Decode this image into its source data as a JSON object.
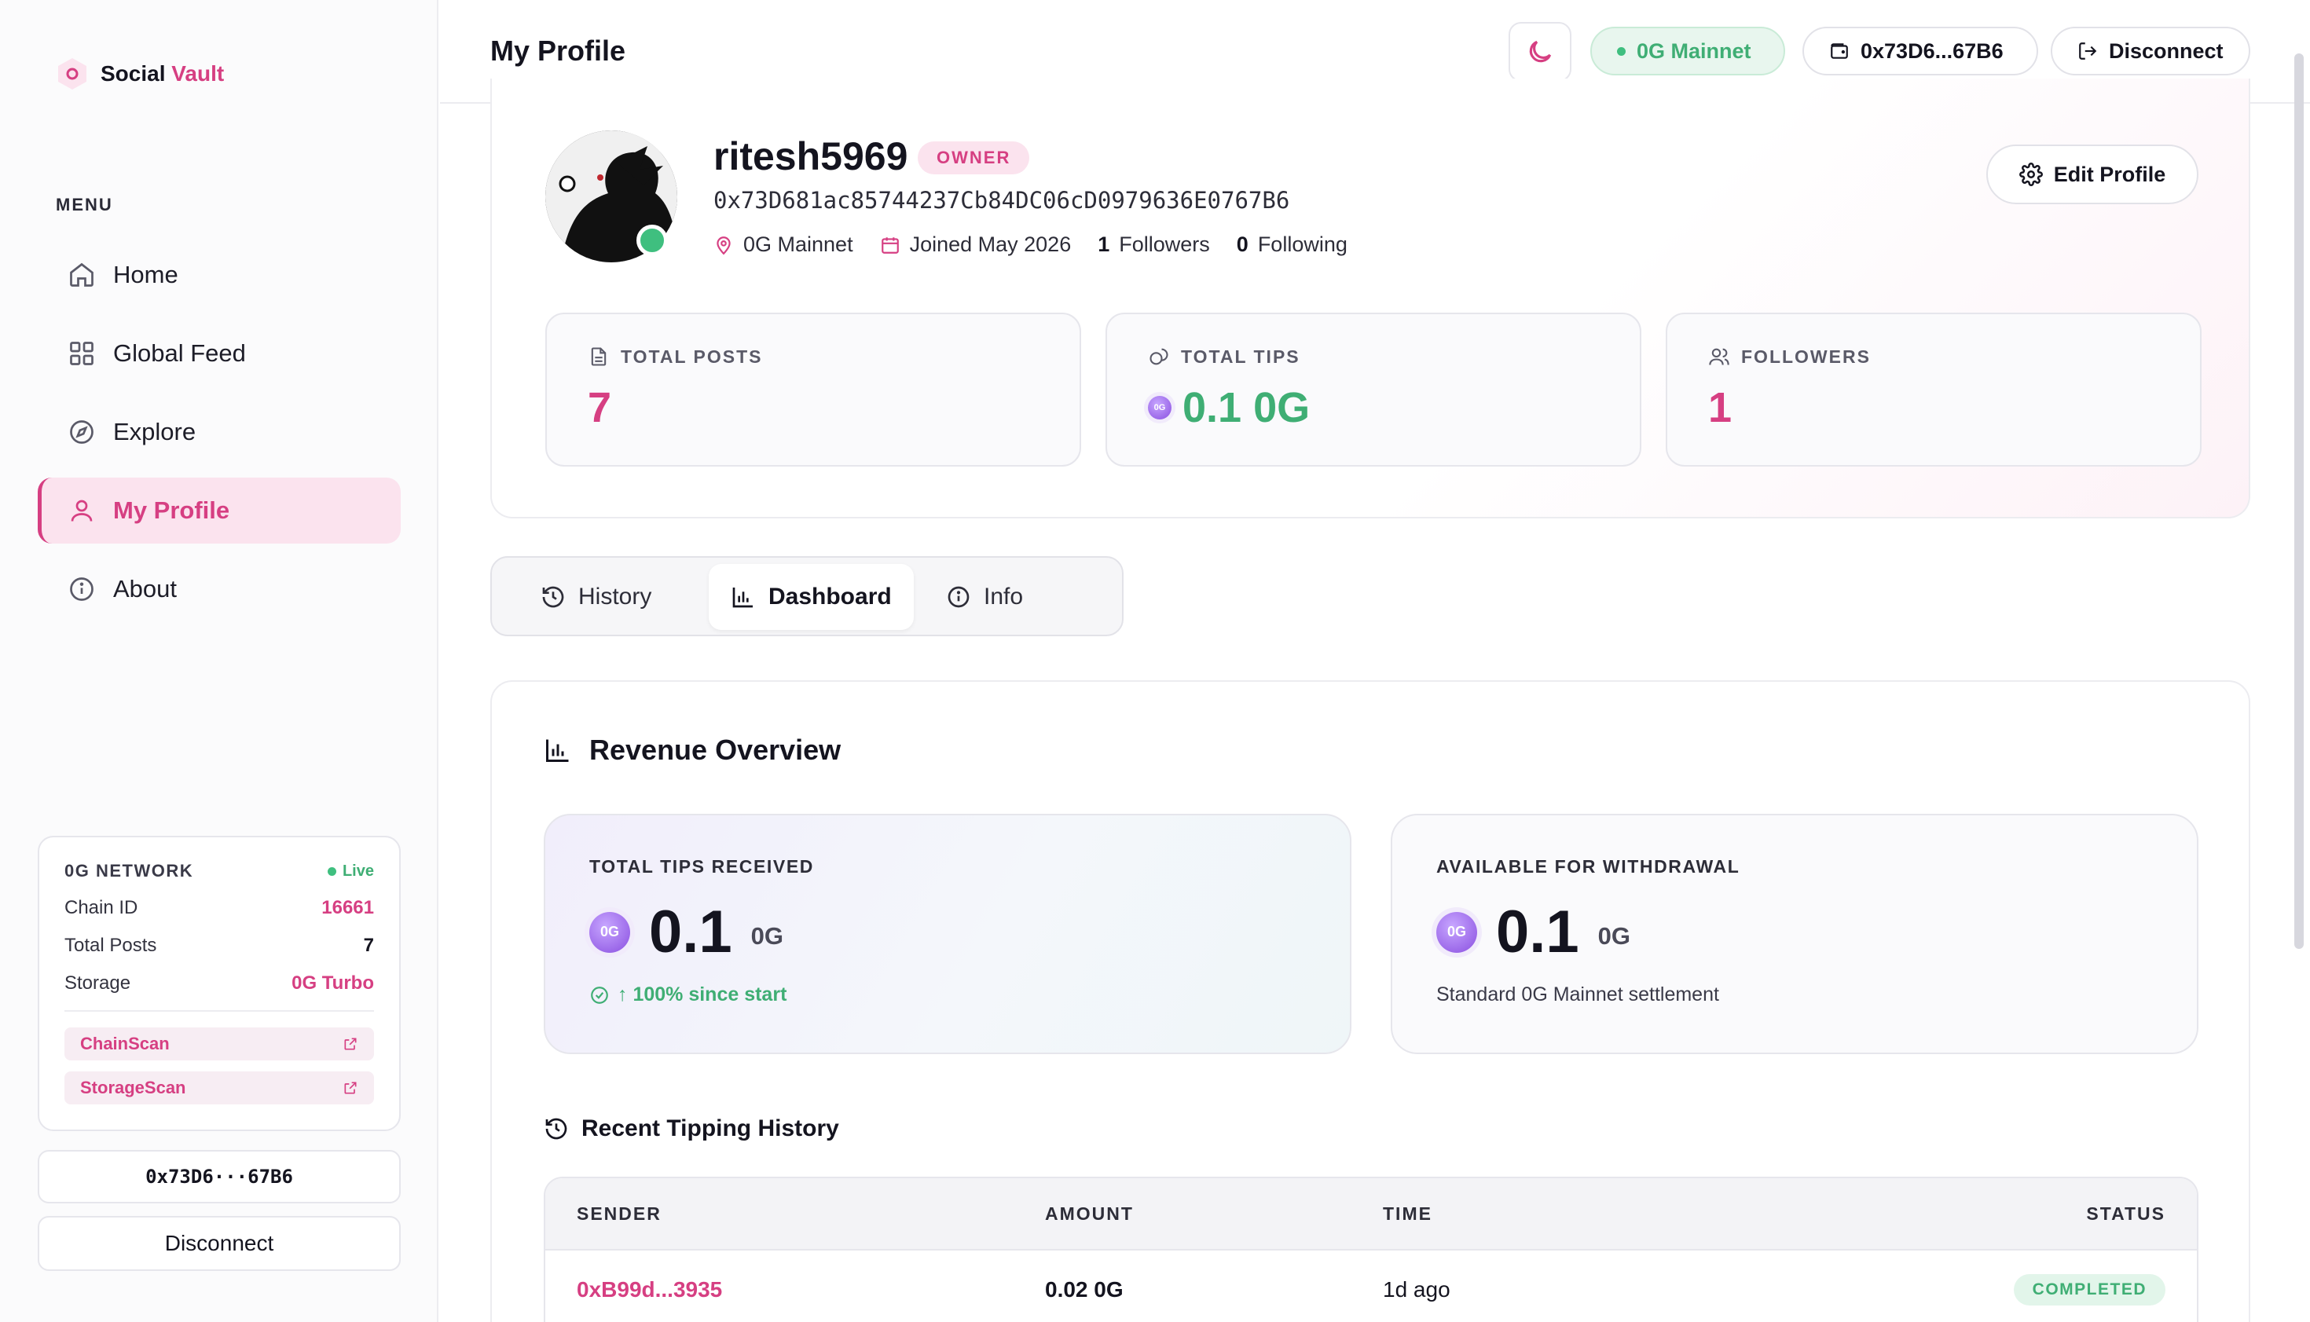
{
  "brand": {
    "part1": "Social",
    "part2": "Vault"
  },
  "sidebar": {
    "menu_label": "MENU",
    "items": [
      {
        "label": "Home",
        "icon": "home-icon"
      },
      {
        "label": "Global Feed",
        "icon": "grid-icon"
      },
      {
        "label": "Explore",
        "icon": "compass-icon"
      },
      {
        "label": "My Profile",
        "icon": "user-icon",
        "active": true
      },
      {
        "label": "About",
        "icon": "info-icon"
      }
    ],
    "network": {
      "title": "0G NETWORK",
      "status": "Live",
      "rows": [
        {
          "key": "Chain ID",
          "value": "16661"
        },
        {
          "key": "Total Posts",
          "value": "7"
        },
        {
          "key": "Storage",
          "value": "0G Turbo"
        }
      ],
      "links": [
        "ChainScan",
        "StorageScan"
      ]
    },
    "address": "0x73D6···67B6",
    "disconnect": "Disconnect"
  },
  "topbar": {
    "title": "My Profile",
    "network": "0G Mainnet",
    "address": "0x73D6...67B6",
    "disconnect": "Disconnect"
  },
  "profile": {
    "username": "ritesh5969",
    "role": "OWNER",
    "address": "0x73D681ac85744237Cb84DC06cD0979636E0767B6",
    "network": "0G Mainnet",
    "joined": "Joined May 2026",
    "followers_count": "1",
    "followers_label": "Followers",
    "following_count": "0",
    "following_label": "Following",
    "edit_label": "Edit Profile"
  },
  "stats": [
    {
      "label": "TOTAL POSTS",
      "value": "7"
    },
    {
      "label": "TOTAL TIPS",
      "value": "0.1 0G"
    },
    {
      "label": "FOLLOWERS",
      "value": "1"
    }
  ],
  "tabs": [
    {
      "label": "History"
    },
    {
      "label": "Dashboard",
      "active": true
    },
    {
      "label": "Info"
    }
  ],
  "revenue": {
    "title": "Revenue Overview",
    "received": {
      "label": "TOTAL TIPS RECEIVED",
      "amount": "0.1",
      "unit": "0G",
      "note": "↑ 100% since start"
    },
    "available": {
      "label": "AVAILABLE FOR WITHDRAWAL",
      "amount": "0.1",
      "unit": "0G",
      "note": "Standard 0G Mainnet settlement"
    }
  },
  "history": {
    "title": "Recent Tipping History",
    "columns": [
      "SENDER",
      "AMOUNT",
      "TIME",
      "STATUS"
    ],
    "rows": [
      {
        "sender": "0xB99d...3935",
        "amount": "0.02 0G",
        "time": "1d ago",
        "status": "COMPLETED"
      }
    ]
  },
  "colors": {
    "accent": "#d63f82",
    "success": "#3fae74"
  }
}
